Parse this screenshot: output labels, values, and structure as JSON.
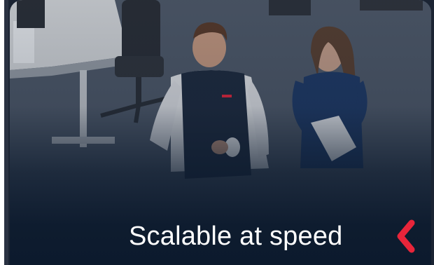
{
  "card": {
    "caption": "Scalable at speed",
    "icon": "chevron-left-icon",
    "accent_color": "#e8253a",
    "photo_description_icon": "office-photo"
  }
}
